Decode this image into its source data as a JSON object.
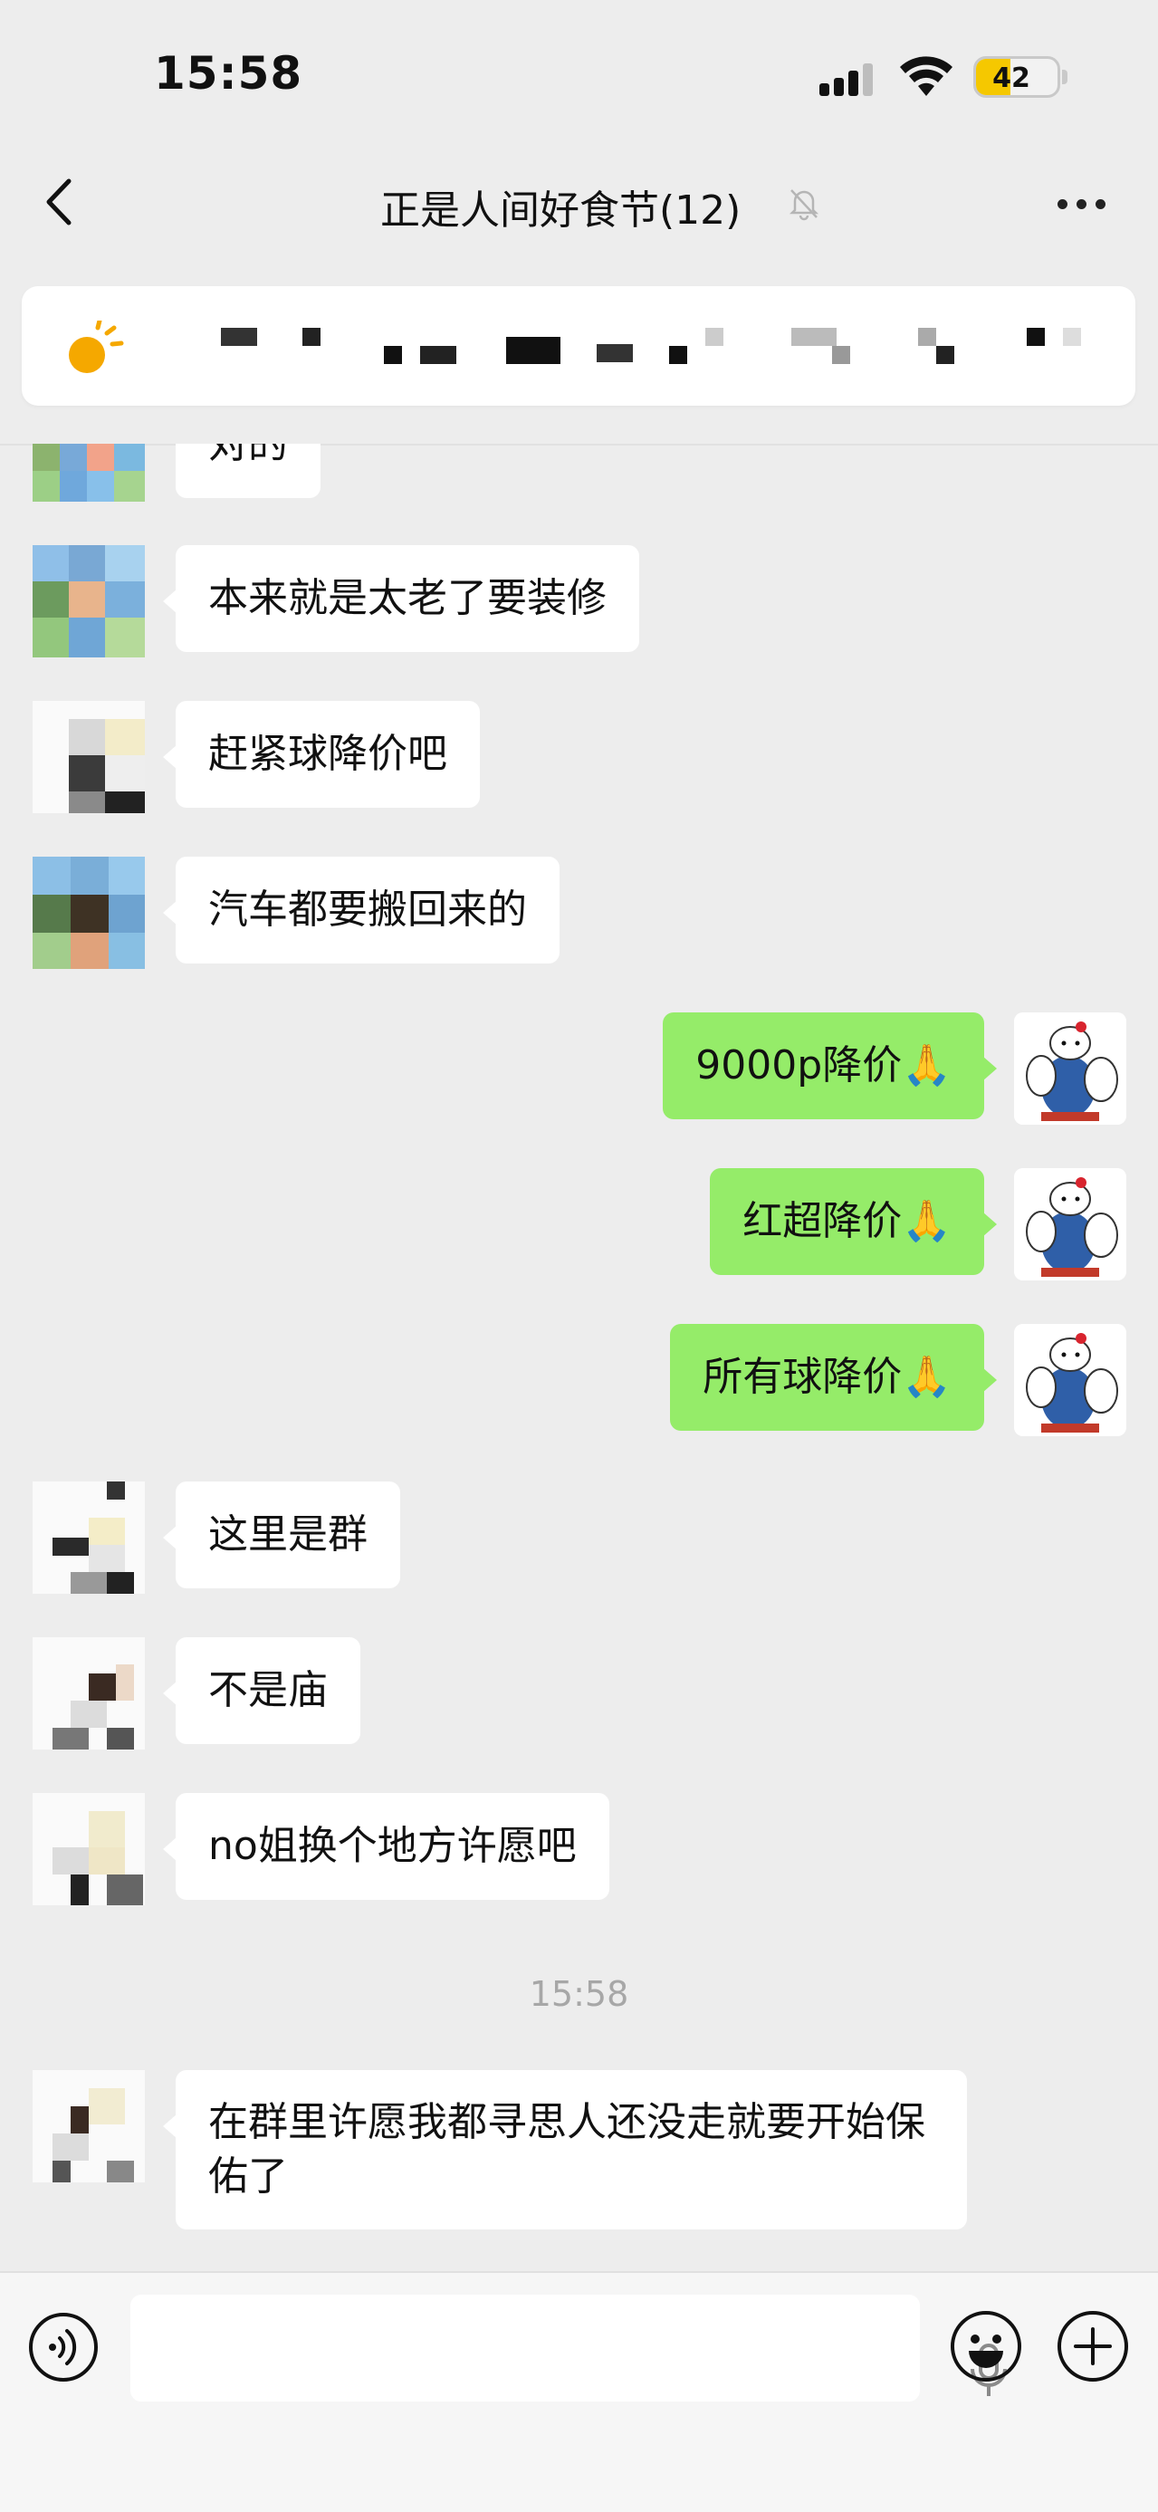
{
  "status_bar": {
    "time": "15:58",
    "battery": "42",
    "battery_level": 0.42
  },
  "nav": {
    "title": "正是人间好食节(12)"
  },
  "messages": [
    {
      "side": "in",
      "text": "对的"
    },
    {
      "side": "in",
      "text": "本来就是太老了要装修"
    },
    {
      "side": "in",
      "text": "赶紧球降价吧"
    },
    {
      "side": "in",
      "text": "汽车都要搬回来的"
    },
    {
      "side": "out",
      "text": "9000p降价",
      "emoji": "🙏"
    },
    {
      "side": "out",
      "text": "红超降价",
      "emoji": "🙏"
    },
    {
      "side": "out",
      "text": "所有球降价",
      "emoji": "🙏"
    },
    {
      "side": "in",
      "text": "这里是群"
    },
    {
      "side": "in",
      "text": "不是庙"
    },
    {
      "side": "in",
      "text": "no姐换个地方许愿吧"
    },
    {
      "side": "in",
      "text": "在群里许愿我都寻思人还没走就要开始保佑了"
    }
  ],
  "timestamp": "15:58",
  "colors": {
    "background": "#ededed",
    "outgoing_bubble": "#95ec69",
    "incoming_bubble": "#ffffff",
    "battery_fill": "#f5c800"
  },
  "icons": [
    "back-arrow-icon",
    "mute-bell-icon",
    "more-icon",
    "weather-sun-icon",
    "voice-icon",
    "mic-icon",
    "emoji-icon",
    "plus-icon"
  ]
}
